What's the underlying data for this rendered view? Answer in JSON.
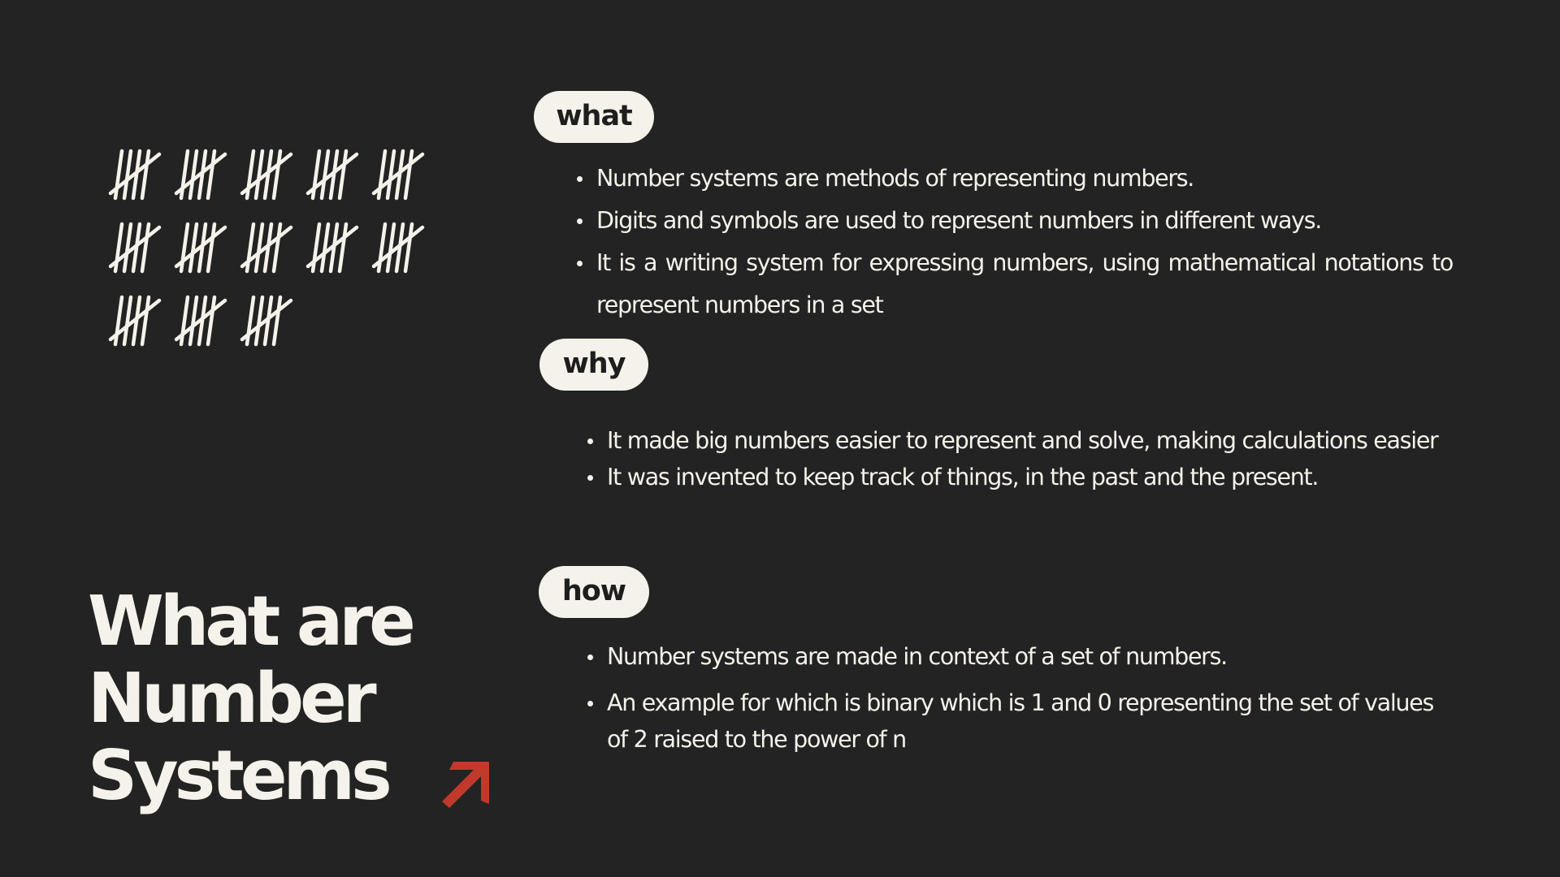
{
  "title": {
    "line1": "What are",
    "line2": "Number",
    "line3": "Systems"
  },
  "icons": {
    "tally": "tally-marks-icon",
    "arrow": "arrow-up-right-icon"
  },
  "colors": {
    "background": "#232323",
    "text": "#f4f2ea",
    "pill_text": "#1e1e1e",
    "accent": "#c0392b"
  },
  "sections": {
    "what": {
      "label": "what",
      "bullets": [
        "Number systems are methods of representing numbers.",
        "Digits and symbols are used to represent numbers in different ways.",
        "It is a writing system for expressing numbers, using mathematical notations to represent numbers in a set"
      ]
    },
    "why": {
      "label": "why",
      "bullets": [
        "It made big numbers easier to represent and solve, making calculations easier",
        "It was invented to keep track of things, in the past and the present."
      ]
    },
    "how": {
      "label": "how",
      "bullets": [
        "Number systems are made in context of a set of numbers.",
        "An example for which is binary which is 1 and 0 representing the set of values of 2 raised to the power of n"
      ]
    }
  }
}
